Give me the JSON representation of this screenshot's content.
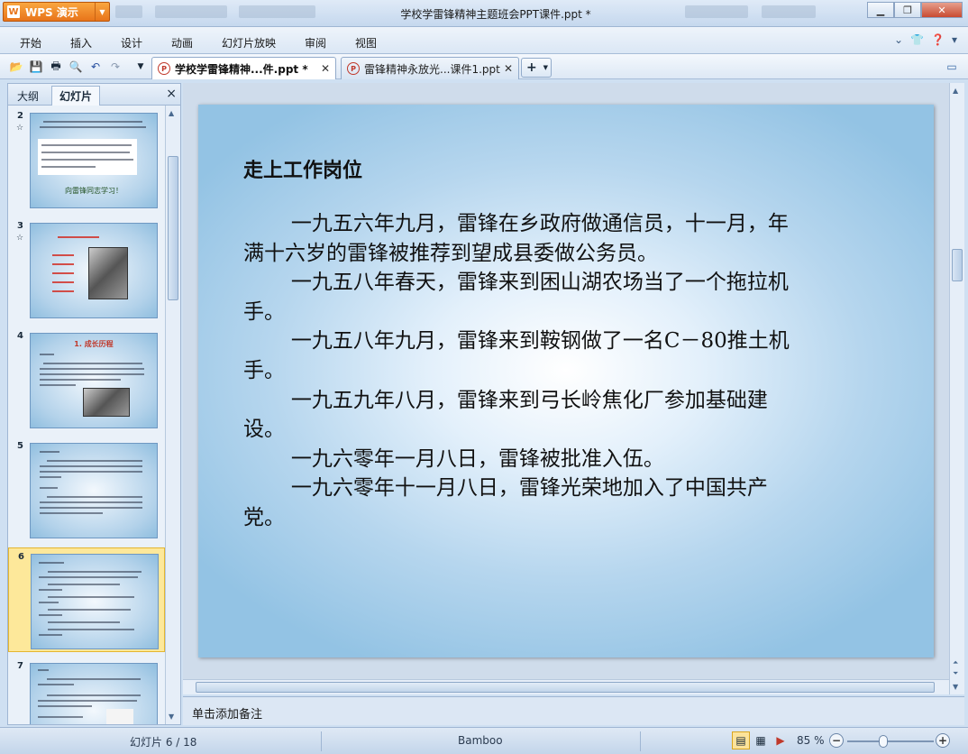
{
  "window": {
    "app_button": "WPS 演示",
    "title": "学校学雷锋精神主题班会PPT课件.ppt *",
    "minimize": "▁",
    "restore": "❐",
    "close": "✕"
  },
  "menu": {
    "items": [
      "开始",
      "插入",
      "设计",
      "动画",
      "幻灯片放映",
      "审阅",
      "视图"
    ]
  },
  "tabs": [
    {
      "label": "学校学雷锋精神...件.ppt *",
      "active": true
    },
    {
      "label": "雷锋精神永放光...课件1.ppt",
      "active": false
    }
  ],
  "left_panel": {
    "tab_outline": "大纲",
    "tab_slides": "幻灯片",
    "close": "×",
    "thumbnails": [
      {
        "number": "2",
        "caption": "向雷锋同志学习！"
      },
      {
        "number": "3",
        "caption": "1. 成长历程"
      },
      {
        "number": "4",
        "caption": "1. 成长历程"
      },
      {
        "number": "5",
        "caption": ""
      },
      {
        "number": "6",
        "caption": ""
      },
      {
        "number": "7",
        "caption": ""
      }
    ]
  },
  "slide": {
    "title": "走上工作岗位",
    "paragraphs": [
      "一九五六年九月，雷锋在乡政府做通信员，十一月，年满十六岁的雷锋被推荐到望成县委做公务员。",
      "一九五八年春天，雷锋来到困山湖农场当了一个拖拉机手。",
      "一九五八年九月，雷锋来到鞍钢做了一名C－80推土机手。",
      "一九五九年八月，雷锋来到弓长岭焦化厂参加基础建设。",
      "一九六零年一月八日，雷锋被批准入伍。",
      "一九六零年十一月八日，雷锋光荣地加入了中国共产党。"
    ]
  },
  "notes": {
    "placeholder": "单击添加备注"
  },
  "status": {
    "slide_counter": "幻灯片 6 / 18",
    "theme": "Bamboo",
    "zoom": "85 %",
    "zoom_minus": "−",
    "zoom_plus": "+",
    "zoom_fraction": 0.42
  },
  "colors": {
    "accent": "#e8741a",
    "selected_thumb": "#fde89a"
  }
}
